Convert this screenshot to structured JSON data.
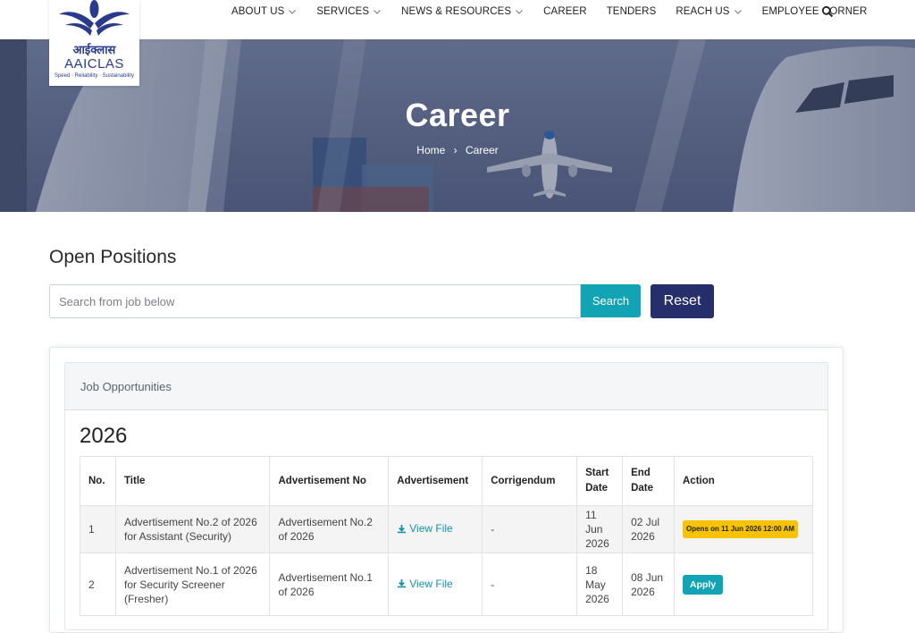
{
  "logo": {
    "hindi": "आईक्लास",
    "latin": "AAICLAS",
    "tagline": "Speed · Reliability · Sustainability",
    "color": "#2a3a8c"
  },
  "nav": {
    "items": [
      {
        "label": "ABOUT US",
        "dropdown": true
      },
      {
        "label": "SERVICES",
        "dropdown": true
      },
      {
        "label": "NEWS & RESOURCES",
        "dropdown": true
      },
      {
        "label": "CAREER",
        "dropdown": false
      },
      {
        "label": "TENDERS",
        "dropdown": false
      },
      {
        "label": "REACH US",
        "dropdown": true
      },
      {
        "label": "EMPLOYEE CORNER",
        "dropdown": false
      }
    ],
    "search_icon": "search-icon"
  },
  "hero": {
    "title": "Career",
    "breadcrumb": {
      "home": "Home",
      "separator": "›",
      "current": "Career"
    }
  },
  "main": {
    "section_title": "Open Positions",
    "search": {
      "placeholder": "Search from job below",
      "value": "",
      "button": "Search"
    },
    "reset_label": "Reset",
    "card": {
      "header": "Job Opportunities",
      "year": "2026",
      "columns": [
        "No.",
        "Title",
        "Advertisement No",
        "Advertisement",
        "Corrigendum",
        "Start Date",
        "End Date",
        "Action"
      ],
      "rows": [
        {
          "no": "1",
          "title": "Advertisement No.2 of 2026 for Assistant (Security)",
          "adv_no": "Advertisement No.2 of 2026",
          "advertisement": "View File",
          "corrigendum": "-",
          "start": "11 Jun 2026",
          "end": "02 Jul 2026",
          "action": "Opens on 11 Jun 2026 12:00 AM"
        },
        {
          "no": "2",
          "title": "Advertisement No.1 of 2026 for Security Screener (Fresher)",
          "adv_no": "Advertisement No.1 of 2026",
          "advertisement": "View File",
          "corrigendum": "-",
          "start": "18 May 2026",
          "end": "08 Jun 2026",
          "action": "Apply"
        }
      ]
    }
  },
  "colors": {
    "accent": "#12a3b5",
    "navy": "#262f6b",
    "badge": "#f7c300"
  }
}
